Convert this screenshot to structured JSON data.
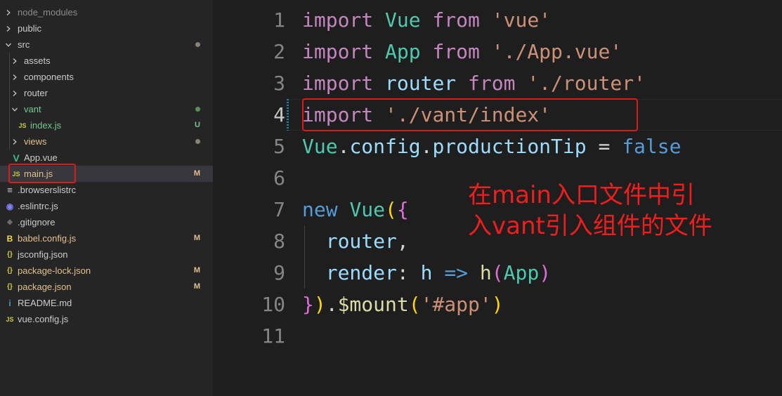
{
  "explorer": {
    "items": [
      {
        "label": "node_modules",
        "kind": "folder",
        "expanded": false,
        "color": "#8b8b8b",
        "status": ""
      },
      {
        "label": "public",
        "kind": "folder",
        "expanded": false,
        "color": "#cccccc",
        "status": ""
      },
      {
        "label": "src",
        "kind": "folder",
        "expanded": true,
        "color": "#cccccc",
        "status": "dot"
      },
      {
        "label": "assets",
        "kind": "folder",
        "expanded": false,
        "color": "#cccccc",
        "status": ""
      },
      {
        "label": "components",
        "kind": "folder",
        "expanded": false,
        "color": "#cccccc",
        "status": ""
      },
      {
        "label": "router",
        "kind": "folder",
        "expanded": false,
        "color": "#cccccc",
        "status": ""
      },
      {
        "label": "vant",
        "kind": "folder",
        "expanded": true,
        "color": "#73c991",
        "status": "dot-green"
      },
      {
        "label": "index.js",
        "kind": "js",
        "color": "#73c991",
        "status": "U"
      },
      {
        "label": "views",
        "kind": "folder",
        "expanded": false,
        "color": "#e2c08d",
        "status": "dot"
      },
      {
        "label": "App.vue",
        "kind": "vue",
        "color": "#cccccc",
        "status": ""
      },
      {
        "label": "main.js",
        "kind": "js",
        "color": "#e2c08d",
        "status": "M"
      },
      {
        "label": ".browserslistrc",
        "kind": "lines",
        "color": "#cccccc",
        "status": ""
      },
      {
        "label": ".eslintrc.js",
        "kind": "eslint",
        "color": "#cccccc",
        "status": ""
      },
      {
        "label": ".gitignore",
        "kind": "git",
        "color": "#cccccc",
        "status": ""
      },
      {
        "label": "babel.config.js",
        "kind": "babel",
        "color": "#e2c08d",
        "status": "M"
      },
      {
        "label": "jsconfig.json",
        "kind": "json",
        "color": "#cccccc",
        "status": ""
      },
      {
        "label": "package-lock.json",
        "kind": "json",
        "color": "#e2c08d",
        "status": "M"
      },
      {
        "label": "package.json",
        "kind": "json",
        "color": "#e2c08d",
        "status": "M"
      },
      {
        "label": "README.md",
        "kind": "info",
        "color": "#cccccc",
        "status": ""
      },
      {
        "label": "vue.config.js",
        "kind": "js",
        "color": "#cccccc",
        "status": ""
      }
    ],
    "icon_text": {
      "js": "JS",
      "json": "{}",
      "vue": "V",
      "babel": "B",
      "info": "i",
      "eslint": "◉",
      "git": "◆",
      "lines": "≡"
    }
  },
  "editor": {
    "active_line": 4,
    "lines": [
      {
        "num": "1",
        "tokens": [
          [
            "kw",
            "import"
          ],
          [
            "punc",
            " "
          ],
          [
            "cls",
            "Vue"
          ],
          [
            "punc",
            " "
          ],
          [
            "kw",
            "from"
          ],
          [
            "punc",
            " "
          ],
          [
            "str",
            "'vue'"
          ]
        ]
      },
      {
        "num": "2",
        "tokens": [
          [
            "kw",
            "import"
          ],
          [
            "punc",
            " "
          ],
          [
            "cls",
            "App"
          ],
          [
            "punc",
            " "
          ],
          [
            "kw",
            "from"
          ],
          [
            "punc",
            " "
          ],
          [
            "str",
            "'./App.vue'"
          ]
        ]
      },
      {
        "num": "3",
        "tokens": [
          [
            "kw",
            "import"
          ],
          [
            "punc",
            " "
          ],
          [
            "var",
            "router"
          ],
          [
            "punc",
            " "
          ],
          [
            "kw",
            "from"
          ],
          [
            "punc",
            " "
          ],
          [
            "str",
            "'./router'"
          ]
        ]
      },
      {
        "num": "4",
        "tokens": [
          [
            "kw",
            "import"
          ],
          [
            "punc",
            " "
          ],
          [
            "str",
            "'./vant/index'"
          ]
        ]
      },
      {
        "num": "5",
        "tokens": [
          [
            "cls",
            "Vue"
          ],
          [
            "punc",
            "."
          ],
          [
            "var",
            "config"
          ],
          [
            "punc",
            "."
          ],
          [
            "var",
            "productionTip"
          ],
          [
            "punc",
            " = "
          ],
          [
            "bool",
            "false"
          ]
        ]
      },
      {
        "num": "6",
        "tokens": []
      },
      {
        "num": "7",
        "tokens": [
          [
            "bool",
            "new"
          ],
          [
            "punc",
            " "
          ],
          [
            "cls",
            "Vue"
          ],
          [
            "paren",
            "("
          ],
          [
            "brace",
            "{"
          ]
        ]
      },
      {
        "num": "8",
        "tokens": [
          [
            "punc",
            "  "
          ],
          [
            "var",
            "router"
          ],
          [
            "punc",
            ","
          ]
        ]
      },
      {
        "num": "9",
        "tokens": [
          [
            "punc",
            "  "
          ],
          [
            "var",
            "render"
          ],
          [
            "punc",
            ": "
          ],
          [
            "var",
            "h"
          ],
          [
            "punc",
            " "
          ],
          [
            "bool",
            "=>"
          ],
          [
            "punc",
            " "
          ],
          [
            "fn",
            "h"
          ],
          [
            "brace",
            "("
          ],
          [
            "cls",
            "App"
          ],
          [
            "brace",
            ")"
          ]
        ]
      },
      {
        "num": "10",
        "tokens": [
          [
            "brace",
            "}"
          ],
          [
            "paren",
            ")"
          ],
          [
            "punc",
            "."
          ],
          [
            "fn",
            "$mount"
          ],
          [
            "paren",
            "("
          ],
          [
            "str",
            "'#app'"
          ],
          [
            "paren",
            ")"
          ]
        ]
      },
      {
        "num": "11",
        "tokens": []
      }
    ]
  },
  "annotation": {
    "line1": "在main入口文件中引",
    "line2": "入vant引入组件的文件",
    "color": "#f21d1d"
  }
}
